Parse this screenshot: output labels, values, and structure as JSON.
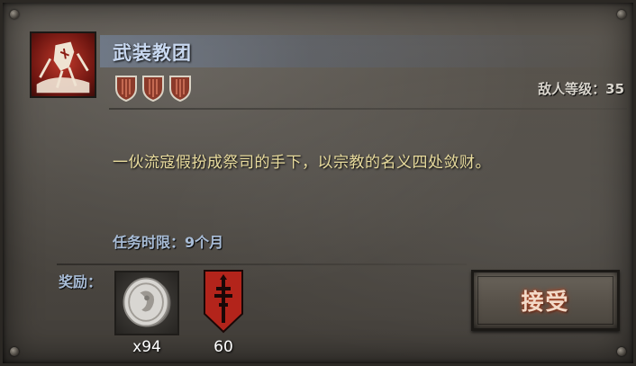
{
  "mission": {
    "title": "武装教团",
    "difficulty_shields": 3,
    "enemy_level_label": "敌人等级：35",
    "description": "一伙流寇假扮成祭司的手下，以宗教的名义四处敛财。",
    "time_limit_label": "任务时限：9个月"
  },
  "rewards": {
    "label": "奖励：",
    "items": [
      {
        "icon": "silver-coin-icon",
        "count": "x94"
      },
      {
        "icon": "red-banner-icon",
        "count": "60"
      }
    ]
  },
  "actions": {
    "accept_label": "接受"
  },
  "colors": {
    "title": "#c8d8f0",
    "description": "#e9dc9e",
    "info": "#a8bcd6",
    "accept_glow": "#b04a2a",
    "shield": "#8b3a2a"
  }
}
